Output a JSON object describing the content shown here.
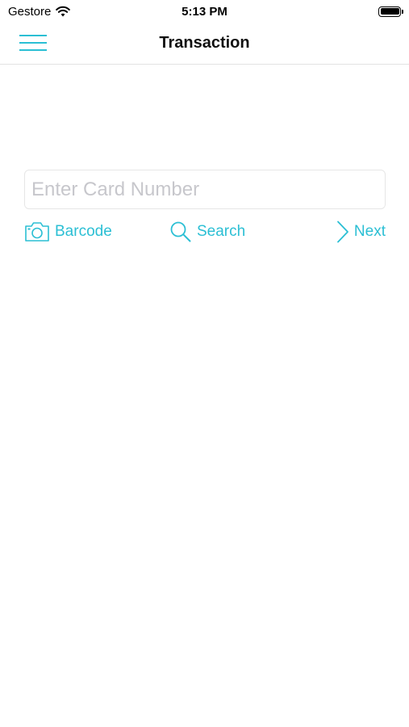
{
  "status_bar": {
    "carrier": "Gestore",
    "time": "5:13 PM",
    "icons": [
      "wifi-icon",
      "battery-icon"
    ]
  },
  "nav": {
    "title": "Transaction",
    "menu_icon": "hamburger-menu-icon"
  },
  "card_input": {
    "value": "",
    "placeholder": "Enter Card Number"
  },
  "actions": {
    "barcode": {
      "label": "Barcode",
      "icon": "camera-icon"
    },
    "search": {
      "label": "Search",
      "icon": "magnifier-icon"
    },
    "next": {
      "label": "Next",
      "icon": "chevron-right-icon"
    }
  },
  "colors": {
    "accent": "#2bbfd4",
    "placeholder": "#c7c7cc",
    "divider": "#e3e3e3"
  }
}
